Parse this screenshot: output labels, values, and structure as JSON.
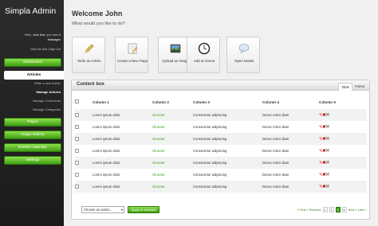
{
  "app": {
    "brand": "Simpla Admin"
  },
  "user": {
    "line1_prefix": "Hello,",
    "name": "John Doe",
    "line1_suffix": ", you have",
    "count": "3",
    "messages": "Messages",
    "view_site": "View the Site",
    "sep": "|",
    "sign_out": "Sign Out"
  },
  "sidebar": {
    "dashboard": "Dashboard",
    "articles": "Articles",
    "sub": [
      "Write a new Article",
      "Manage Articles",
      "Manage Comments",
      "Manage Categories"
    ],
    "pages": "Pages",
    "gallery": "Image Gallery",
    "events": "Events Calendar",
    "settings": "Settings"
  },
  "header": {
    "welcome": "Welcome John",
    "subtitle": "What would you like to do?"
  },
  "shortcuts": [
    {
      "label": "Write an Article",
      "icon": "pencil-icon"
    },
    {
      "label": "Create a New Page",
      "icon": "new-page-icon"
    },
    {
      "label": "Upload an Image",
      "icon": "image-icon"
    },
    {
      "label": "Add an Event",
      "icon": "clock-icon"
    },
    {
      "label": "Open Modal",
      "icon": "speech-bubble-icon"
    }
  ],
  "content_box": {
    "title": "Content box",
    "tabs": [
      "Table",
      "Forms"
    ],
    "columns": [
      "Column 1",
      "Column 2",
      "Column 3",
      "Column 4",
      "Column 5"
    ],
    "rows": [
      [
        "Lorem ipsum dolor",
        "Sit amet",
        "Consectetur adipiscing",
        "Donec tortor diam"
      ],
      [
        "Lorem ipsum dolor",
        "Sit amet",
        "Consectetur adipiscing",
        "Donec tortor diam"
      ],
      [
        "Lorem ipsum dolor",
        "Sit amet",
        "Consectetur adipiscing",
        "Donec tortor diam"
      ],
      [
        "Lorem ipsum dolor",
        "Sit amet",
        "Consectetur adipiscing",
        "Donec tortor diam"
      ],
      [
        "Lorem ipsum dolor",
        "Sit amet",
        "Consectetur adipiscing",
        "Donec tortor diam"
      ],
      [
        "Lorem ipsum dolor",
        "Sit amet",
        "Consectetur adipiscing",
        "Donec tortor diam"
      ],
      [
        "Lorem ipsum dolor",
        "Sit amet",
        "Consectetur adipiscing",
        "Donec tortor diam"
      ]
    ],
    "bulk_select": "Choose an action...",
    "bulk_button": "Apply to selected",
    "pager": {
      "first": "« First",
      "prev": "« Previous",
      "pages": [
        "1",
        "2",
        "3",
        "4"
      ],
      "current": "3",
      "next": "Next »",
      "last": "Last »"
    }
  },
  "colors": {
    "accent": "#3f9e14",
    "sidebar": "#222222"
  }
}
